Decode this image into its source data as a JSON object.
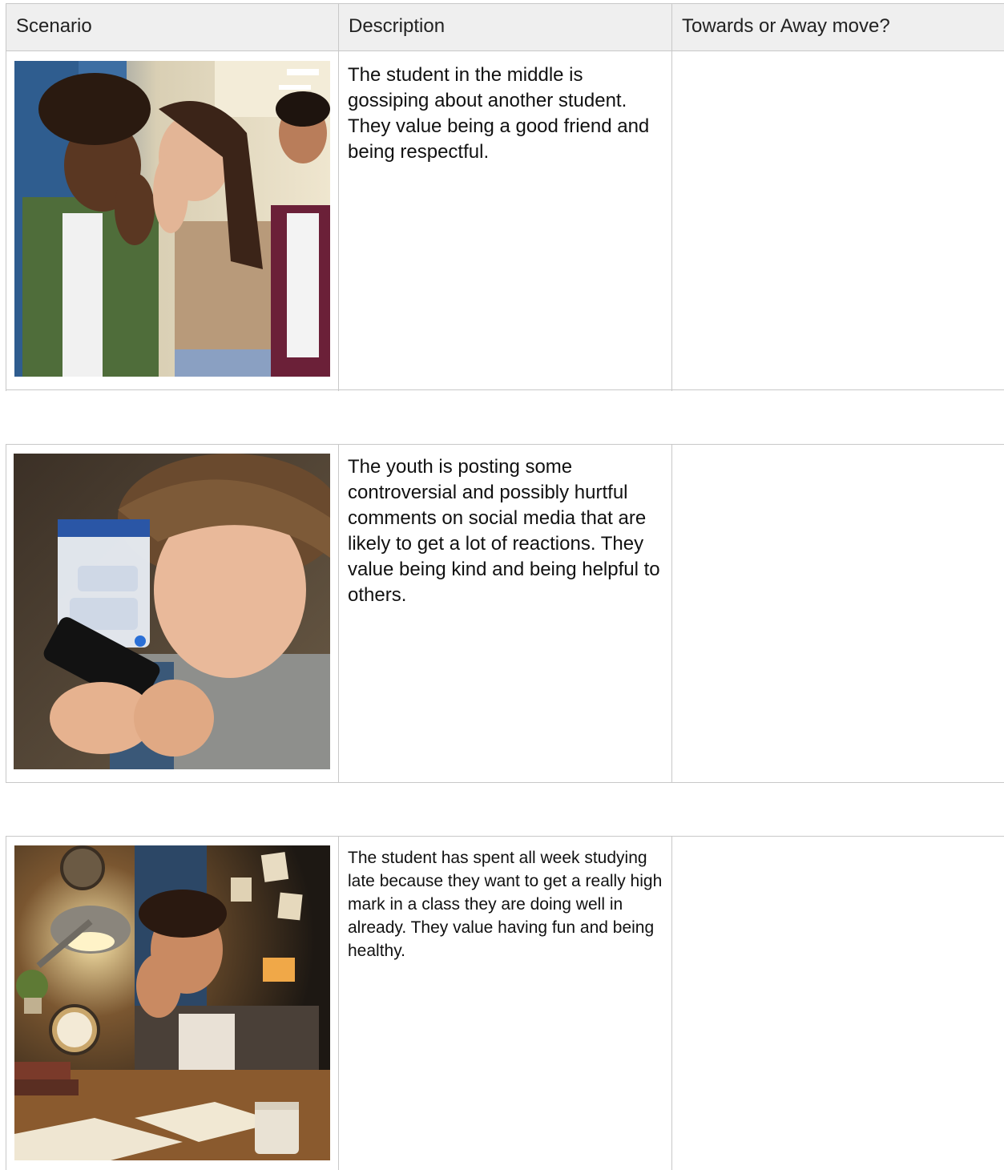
{
  "table": {
    "headers": [
      "Scenario",
      "Description",
      "Towards or Away move?"
    ],
    "rows": [
      {
        "image_icon": "photo-students-whispering-icon",
        "description": "The student in the middle is gossiping about another student. They value being a good friend and being respectful.",
        "answer": ""
      },
      {
        "image_icon": "photo-youth-on-phone-icon",
        "description": "The youth is posting some controversial and possibly hurtful comments on social media that are likely to get a lot of reactions. They value being kind and being helpful to others.",
        "answer": ""
      },
      {
        "image_icon": "photo-tired-student-studying-icon",
        "description": "The student has spent all week studying late because they want to get a really high mark in a class they are doing well in already. They value having fun and being healthy.",
        "answer": ""
      }
    ]
  }
}
